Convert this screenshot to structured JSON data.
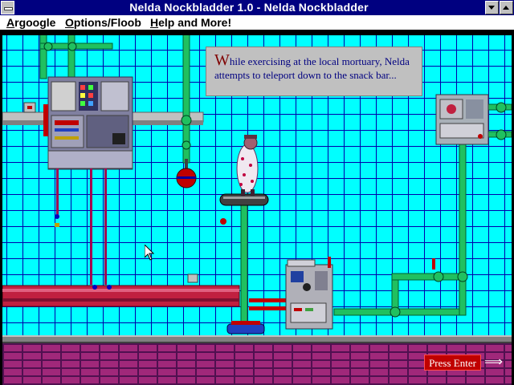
{
  "window": {
    "title": "Nelda Nockbladder 1.0 - Nelda Nockbladder"
  },
  "menu": {
    "items": [
      {
        "label": "Argoogle",
        "underline": "A"
      },
      {
        "label": "Options/Floob",
        "underline": "O"
      },
      {
        "label": "Help and More!",
        "underline": "H"
      }
    ]
  },
  "game": {
    "message": {
      "first_letter": "W",
      "text": "hile exercising at the local mortuary, Nelda attempts to teleport down to the snack bar..."
    },
    "press_enter_label": "Press Enter",
    "arrow_glyph": "⟹",
    "colors": {
      "wall": "#00ffff",
      "grid": "#0000aa",
      "pipe": "#20c060",
      "floor": "#a0287a",
      "message_text": "#000080",
      "press_enter_bg": "#c00000"
    }
  }
}
